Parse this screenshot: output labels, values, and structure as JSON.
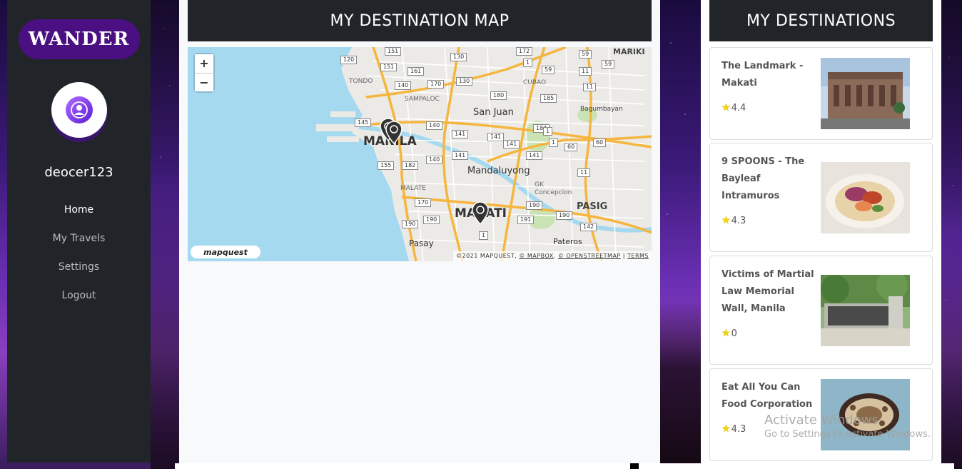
{
  "app": {
    "logo": "WANDER",
    "username": "deocer123"
  },
  "nav": [
    {
      "label": "Home",
      "active": true
    },
    {
      "label": "My Travels",
      "active": false
    },
    {
      "label": "Settings",
      "active": false
    },
    {
      "label": "Logout",
      "active": false
    }
  ],
  "map_panel": {
    "title": "MY DESTINATION MAP",
    "zoom_in": "+",
    "zoom_out": "−",
    "logo": "mapquest",
    "attribution_prefix": "©2021 MAPQUEST, ",
    "attribution_mapbox": "© MAPBOX",
    "attribution_osm": "© OPENSTREETMAP",
    "attribution_terms": "TERMS",
    "places": [
      "MANILA",
      "MAKATI",
      "PASIG",
      "Mandaluyong",
      "San Juan",
      "SAMPALOC",
      "TONDO",
      "MALATE",
      "Pasay",
      "Pateros",
      "CUBAO",
      "Bagumbayan",
      "MARIKI",
      "GK Concepcion"
    ],
    "road_numbers": [
      "151",
      "130",
      "172",
      "59",
      "120",
      "151",
      "161",
      "1",
      "59",
      "11",
      "59",
      "140",
      "170",
      "130",
      "185",
      "11",
      "180",
      "145",
      "140",
      "141",
      "184",
      "1",
      "141",
      "141",
      "141",
      "60",
      "60",
      "155",
      "182",
      "140",
      "141",
      "1",
      "11",
      "170",
      "190",
      "190",
      "190",
      "191",
      "190",
      "142",
      "1"
    ],
    "colors": {
      "water": "#a5d9f0",
      "road_major": "#f5b63f",
      "road_minor": "#ffffff",
      "land": "#eceae6"
    }
  },
  "destinations_panel": {
    "title": "MY DESTINATIONS",
    "items": [
      {
        "name": "The Landmark - Makati",
        "rating": "4.4",
        "image": "building"
      },
      {
        "name": "9 SPOONS - The Bayleaf Intramuros",
        "rating": "4.3",
        "image": "food-bowl"
      },
      {
        "name": "Victims of Martial Law Memorial Wall, Manila",
        "rating": "0",
        "image": "memorial-wall"
      },
      {
        "name": "Eat All You Can Food Corporation",
        "rating": "4.3",
        "image": "food-plate"
      }
    ]
  },
  "watermark": {
    "title": "Activate Windows",
    "subtitle": "Go to Settings to activate Windows."
  }
}
